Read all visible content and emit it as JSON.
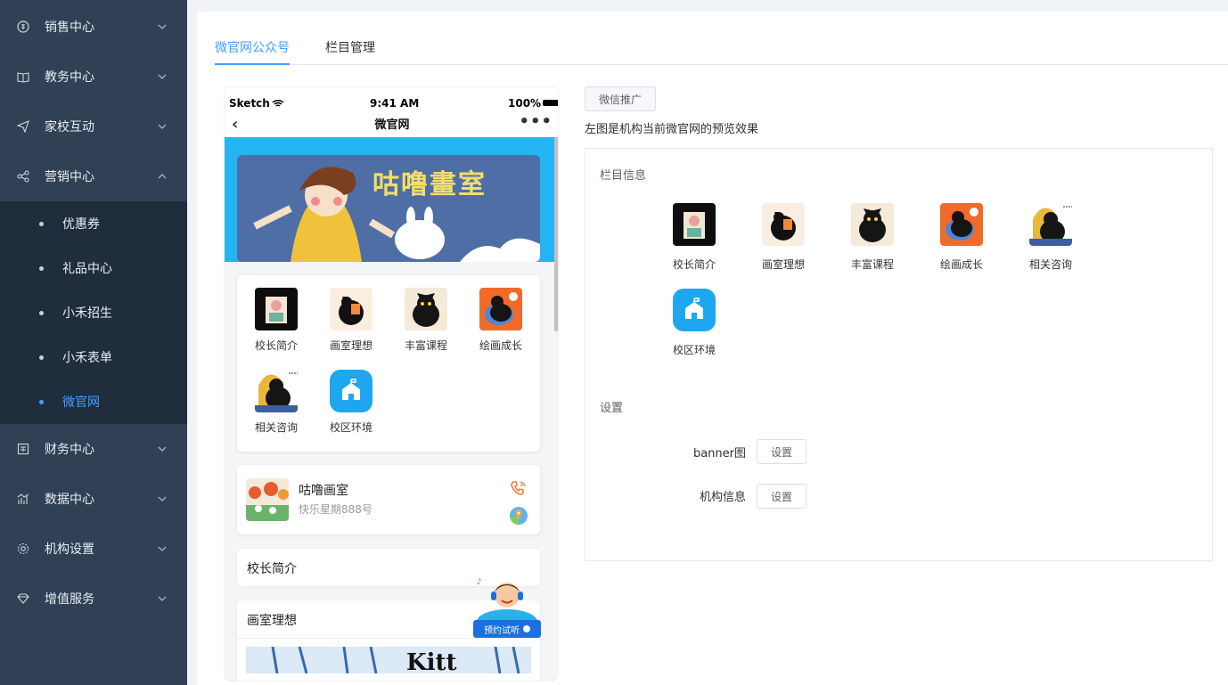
{
  "sidebar": {
    "items": [
      {
        "label": "销售中心",
        "icon": "dollar-circle-icon"
      },
      {
        "label": "教务中心",
        "icon": "book-icon"
      },
      {
        "label": "家校互动",
        "icon": "send-icon"
      },
      {
        "label": "营销中心",
        "icon": "share-icon"
      },
      {
        "label": "财务中心",
        "icon": "finance-icon"
      },
      {
        "label": "数据中心",
        "icon": "chart-icon"
      },
      {
        "label": "机构设置",
        "icon": "gear-icon"
      },
      {
        "label": "增值服务",
        "icon": "diamond-icon"
      }
    ],
    "submenu": [
      "优惠券",
      "礼品中心",
      "小禾招生",
      "小禾表单",
      "微官网"
    ],
    "active_sub": "微官网"
  },
  "tabs": [
    "微官网公众号",
    "栏目管理"
  ],
  "phone": {
    "status": {
      "carrier": "Sketch",
      "time": "9:41 AM",
      "battery": "100%"
    },
    "nav_title": "微官网",
    "banner_text": "咕噜畫室",
    "grid": [
      "校长简介",
      "画室理想",
      "丰富课程",
      "绘画成长",
      "相关咨询",
      "校区环境"
    ],
    "store": {
      "name": "咕噜画室",
      "address": "快乐星期888号"
    },
    "sections": [
      "校长简介",
      "画室理想"
    ],
    "fab_label": "预约试听"
  },
  "right": {
    "promo_button": "微信推广",
    "hint": "左图是机构当前微官网的预览效果",
    "panel_title": "栏目信息",
    "grid": [
      "校长简介",
      "画室理想",
      "丰富课程",
      "绘画成长",
      "相关咨询",
      "校区环境"
    ],
    "settings_title": "设置",
    "settings": [
      {
        "label": "banner图",
        "button": "设置"
      },
      {
        "label": "机构信息",
        "button": "设置"
      }
    ]
  },
  "colors": {
    "sidebar": "#304156",
    "submenu": "#1f2d3d",
    "accent": "#409eff",
    "phone_header": "#25b4f2"
  }
}
